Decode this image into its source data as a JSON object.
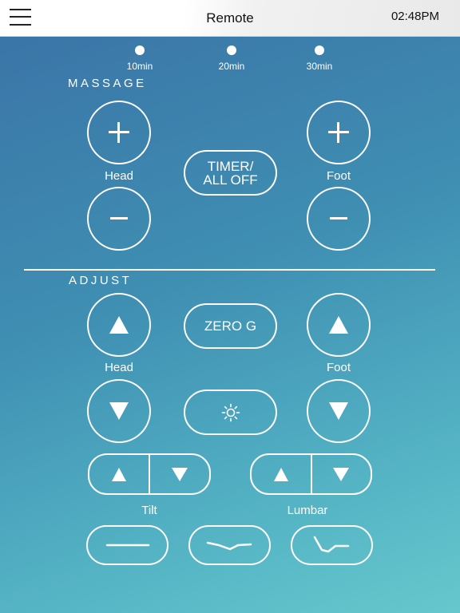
{
  "header": {
    "title": "Remote",
    "time": "02:48PM"
  },
  "timer": {
    "options": [
      {
        "label": "10min"
      },
      {
        "label": "20min"
      },
      {
        "label": "30min"
      }
    ],
    "button_label": "TIMER/\nALL OFF"
  },
  "massage": {
    "section_title": "MASSAGE",
    "head_label": "Head",
    "foot_label": "Foot"
  },
  "adjust": {
    "section_title": "ADJUST",
    "head_label": "Head",
    "foot_label": "Foot",
    "zero_g_label": "ZERO G"
  },
  "tilt": {
    "label": "Tilt"
  },
  "lumbar": {
    "label": "Lumbar"
  },
  "icons": {
    "menu": "hamburger-menu-icon",
    "plus": "plus-icon",
    "minus": "minus-icon",
    "up": "up-arrow-icon",
    "down": "down-arrow-icon",
    "light": "sun-icon",
    "preset_flat": "flat-position-icon",
    "preset_lounge": "lounge-position-icon",
    "preset_tv": "tv-position-icon"
  },
  "colors": {
    "background_top": "#3a72a6",
    "background_bottom": "#66c8cd",
    "foreground": "#ffffff"
  }
}
